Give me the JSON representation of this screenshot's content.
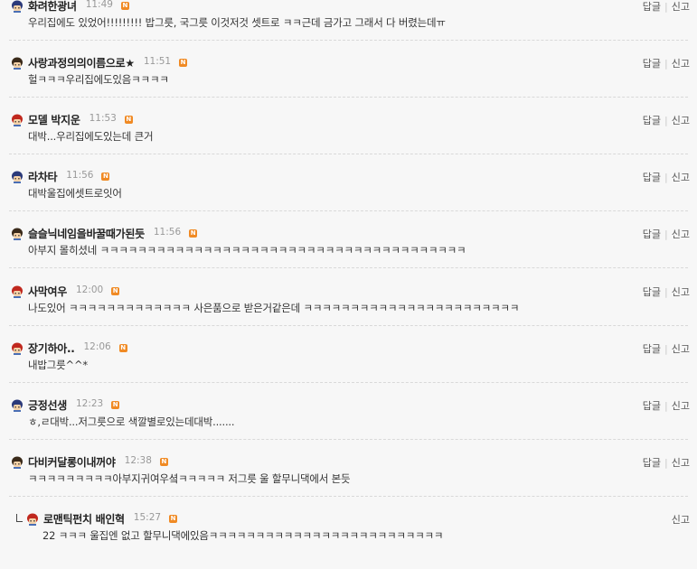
{
  "labels": {
    "reply": "답글",
    "report": "신고",
    "badge": "N"
  },
  "comments": [
    {
      "nick": "화려한광녀",
      "time": "11:49",
      "text": "우리집에도 있었어!!!!!!!!! 밥그릇, 국그릇 이것저것 셋트로 ㅋㅋ근데 금가고 그래서 다 버렸는데ㅠ",
      "avatar": "boy"
    },
    {
      "nick": "사랑과정의의이름으로★",
      "time": "11:51",
      "text": "헐ㅋㅋㅋ우리집에도있음ㅋㅋㅋㅋ",
      "avatar": "girl"
    },
    {
      "nick": "모델 박지운",
      "time": "11:53",
      "text": "대박...우리집에도있는데 큰거",
      "avatar": "red"
    },
    {
      "nick": "라차타",
      "time": "11:56",
      "text": "대박울집에셋트로잇어",
      "avatar": "boy"
    },
    {
      "nick": "슬슬닉네임을바꿀때가된듯",
      "time": "11:56",
      "text": "아부지 몰히셨네 ㅋㅋㅋㅋㅋㅋㅋㅋㅋㅋㅋㅋㅋㅋㅋㅋㅋㅋㅋㅋㅋㅋㅋㅋㅋㅋㅋㅋㅋㅋㅋㅋㅋㅋㅋㅋㅋㅋㅋ",
      "avatar": "girl"
    },
    {
      "nick": "사막여우",
      "time": "12:00",
      "text": "나도있어 ㅋㅋㅋㅋㅋㅋㅋㅋㅋㅋㅋㅋㅋ 사은품으로 받은거같은데 ㅋㅋㅋㅋㅋㅋㅋㅋㅋㅋㅋㅋㅋㅋㅋㅋㅋㅋㅋㅋㅋㅋㅋ",
      "avatar": "red"
    },
    {
      "nick": "장기하아..",
      "time": "12:06",
      "text": "내밥그릇^^*",
      "avatar": "red"
    },
    {
      "nick": "긍정선생",
      "time": "12:23",
      "text": "ㅎ,ㄹ대박...저그릇으로 색깔별로있는데대박.......",
      "avatar": "boy"
    },
    {
      "nick": "다비커달롱이내꺼야",
      "time": "12:38",
      "text": "ㅋㅋㅋㅋㅋㅋㅋㅋㅋ아부지귀여우셬ㅋㅋㅋㅋㅋ 저그릇 울 할무니댁에서 본듯",
      "avatar": "girl"
    },
    {
      "nick": "로맨틱펀치 배인혁",
      "time": "15:27",
      "text": "22 ㅋㅋㅋ 울집엔 없고 할무니댁에있음ㅋㅋㅋㅋㅋㅋㅋㅋㅋㅋㅋㅋㅋㅋㅋㅋㅋㅋㅋㅋㅋㅋㅋㅋㅋ",
      "avatar": "red",
      "is_reply": true
    }
  ]
}
